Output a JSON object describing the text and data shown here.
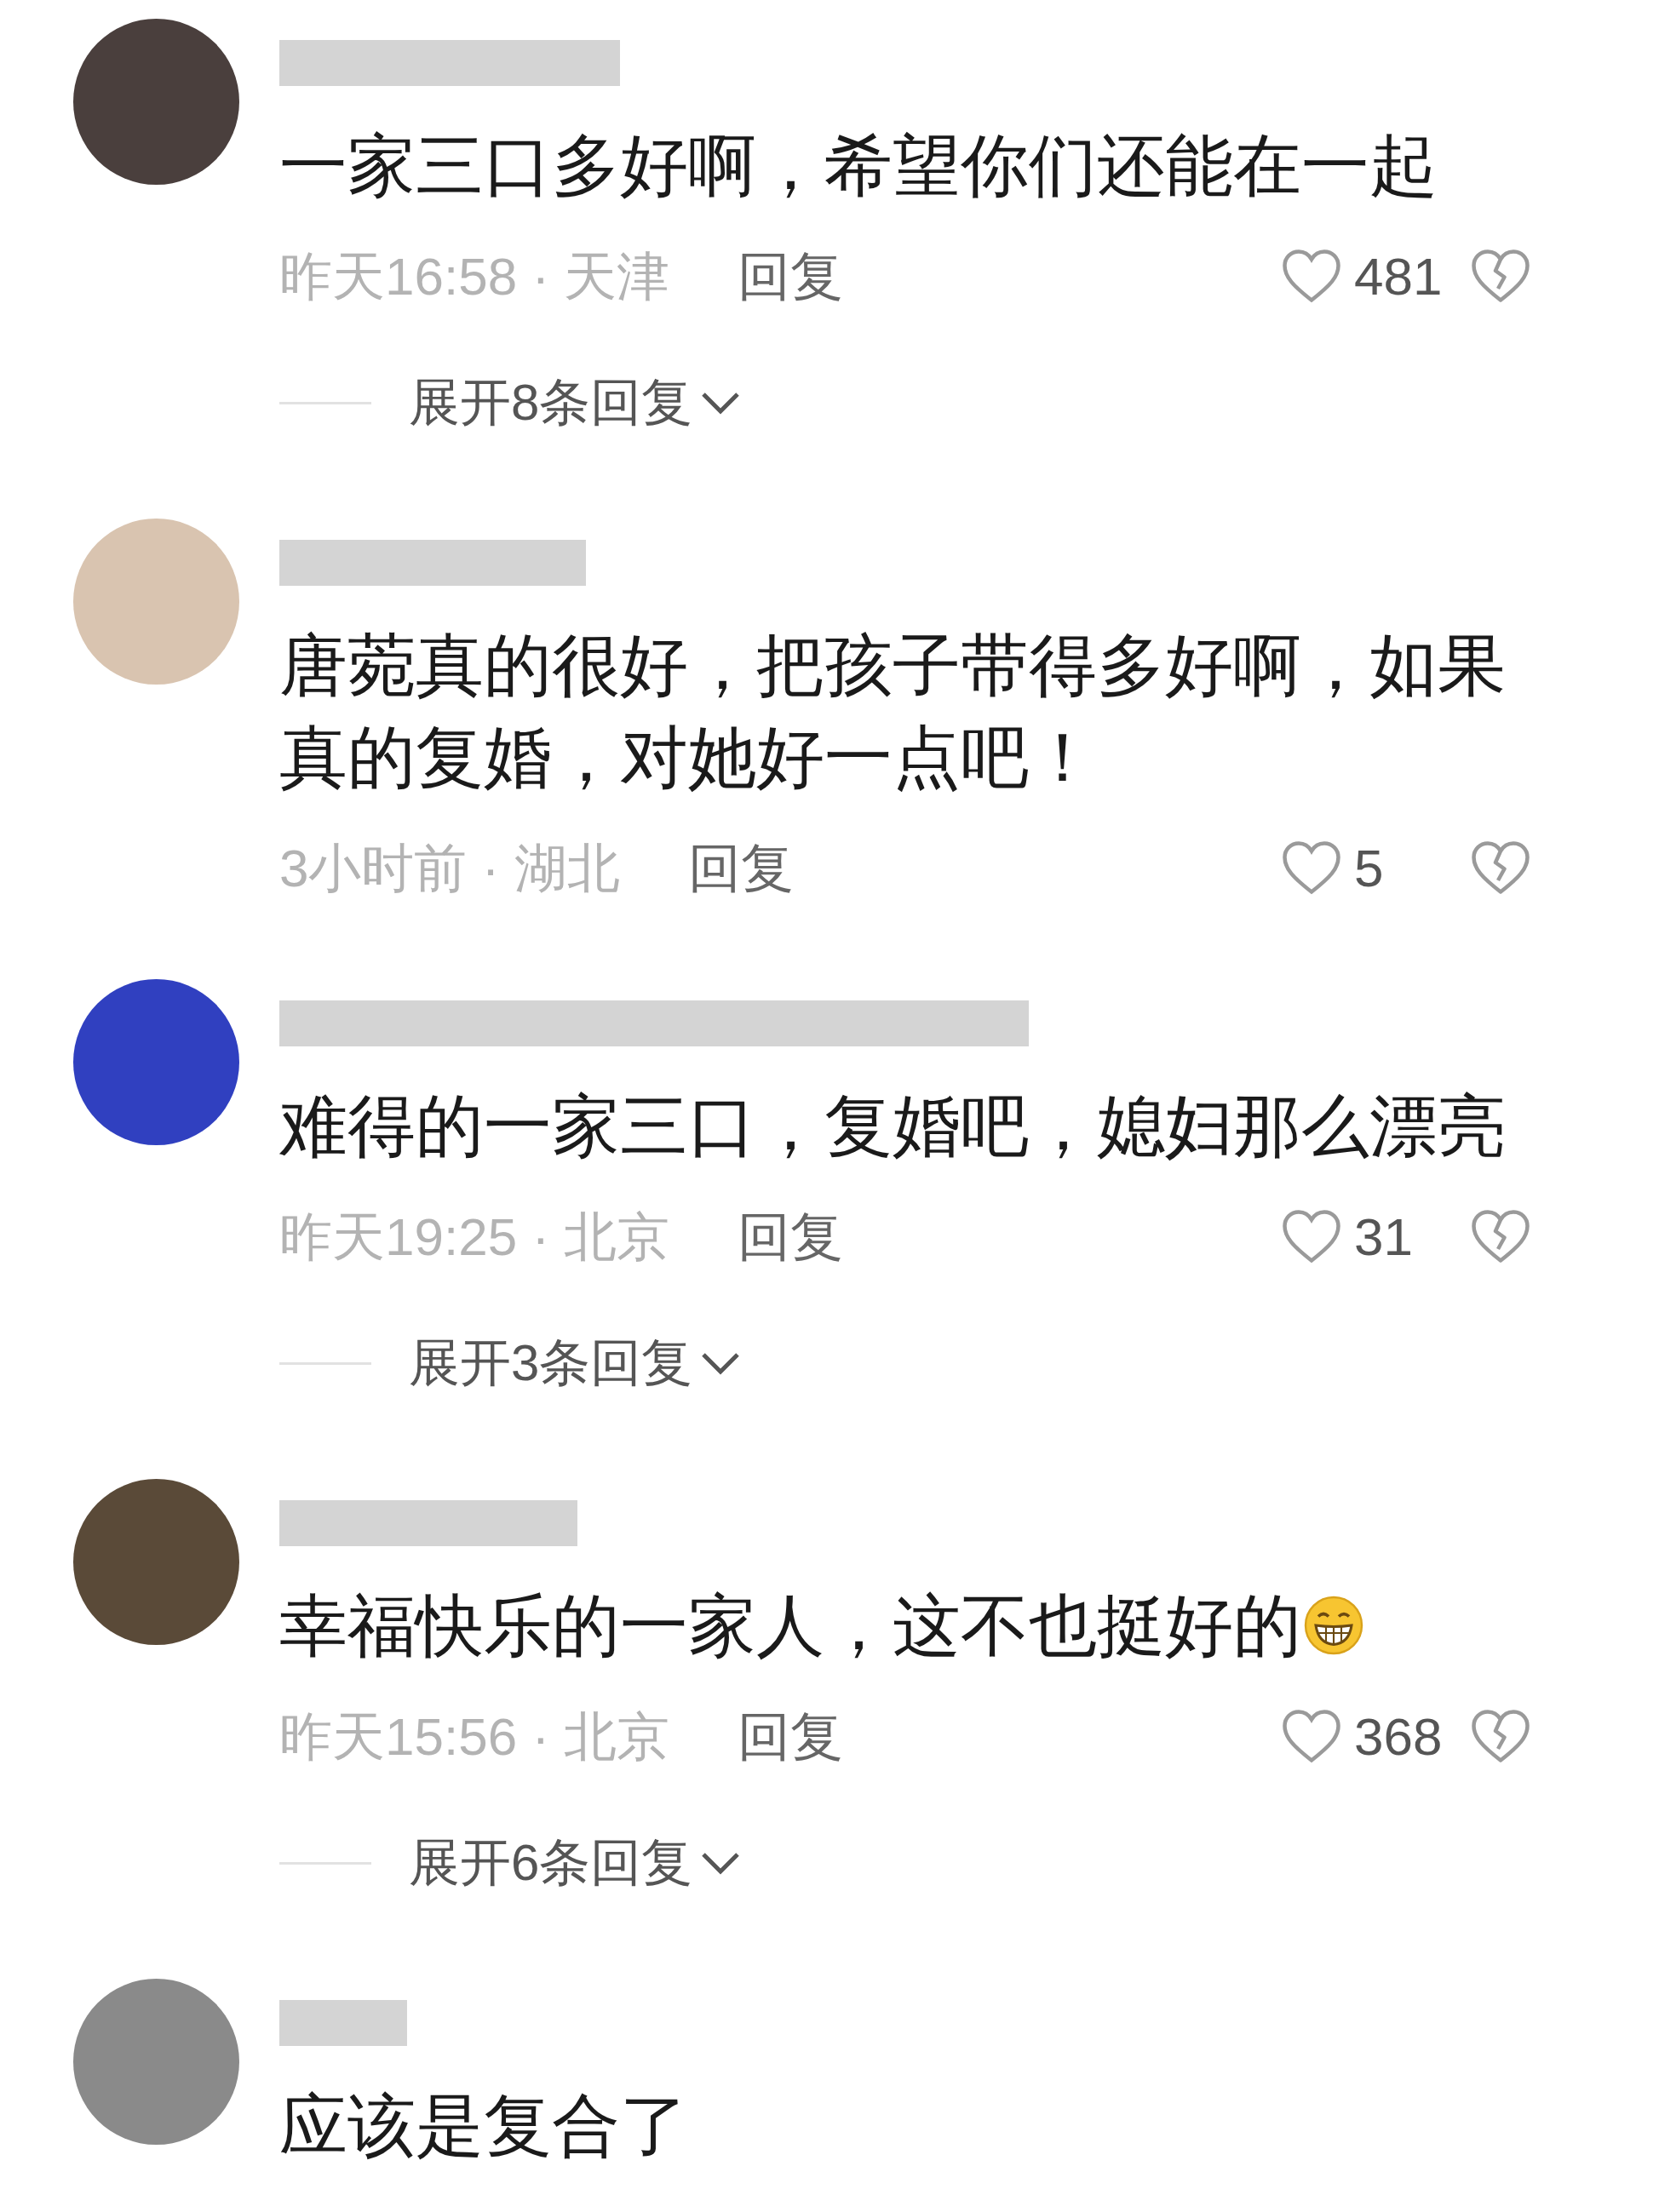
{
  "comments": [
    {
      "text": "一家三口多好啊，希望你们还能在一起",
      "meta": "昨天16:58 · 天津",
      "reply": "回复",
      "likes": "481",
      "expand": "展开8条回复"
    },
    {
      "text": "唐菀真的很好，把孩子带得多好啊，如果真的复婚，对她好一点吧！",
      "meta": "3小时前 · 湖北",
      "reply": "回复",
      "likes": "5"
    },
    {
      "text": "难得的一家三口，复婚吧，媳妇那么漂亮",
      "meta": "昨天19:25 · 北京",
      "reply": "回复",
      "likes": "31",
      "expand": "展开3条回复"
    },
    {
      "text": "幸福快乐的一家人，这不也挺好的",
      "emoji_after": true,
      "meta": "昨天15:56 · 北京",
      "reply": "回复",
      "likes": "368",
      "expand": "展开6条回复"
    },
    {
      "text": "应该是复合了"
    }
  ]
}
